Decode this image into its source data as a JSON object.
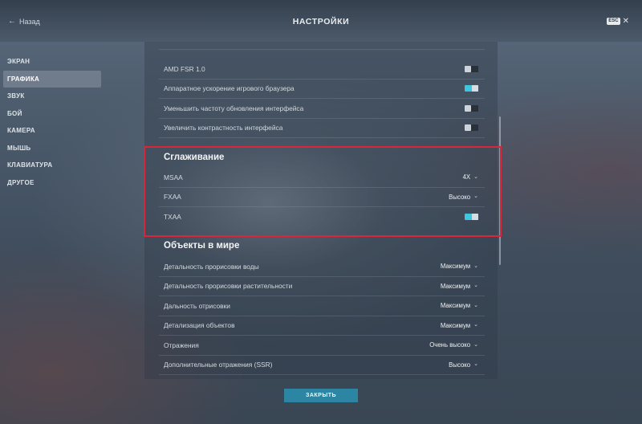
{
  "header": {
    "back_label": "Назад",
    "title": "НАСТРОЙКИ",
    "esc_key": "ESC",
    "close_glyph": "✕",
    "back_icon": "arrow-left-icon"
  },
  "sidebar": {
    "items": [
      {
        "label": "ЭКРАН"
      },
      {
        "label": "ГРАФИКА",
        "active": true
      },
      {
        "label": "ЗВУК"
      },
      {
        "label": "БОЙ"
      },
      {
        "label": "КАМЕРА"
      },
      {
        "label": "МЫШЬ"
      },
      {
        "label": "КЛАВИАТУРА"
      },
      {
        "label": "ДРУГОЕ"
      }
    ]
  },
  "top_toggles": [
    {
      "label": "AMD FSR 1.0",
      "state": "off"
    },
    {
      "label": "Аппаратное ускорение игрового браузера",
      "state": "on"
    },
    {
      "label": "Уменьшить частоту обновления интерфейса",
      "state": "off"
    },
    {
      "label": "Увеличить контрастность интерфейса",
      "state": "off"
    }
  ],
  "antialiasing": {
    "title": "Сглаживание",
    "msaa": {
      "label": "MSAA",
      "value": "4X"
    },
    "fxaa": {
      "label": "FXAA",
      "value": "Высоко"
    },
    "txaa": {
      "label": "TXAA",
      "state": "on"
    }
  },
  "world_objects": {
    "title": "Объекты в мире",
    "rows": [
      {
        "label": "Детальность прорисовки воды",
        "value": "Максимум"
      },
      {
        "label": "Детальность прорисовки растительности",
        "value": "Максимум"
      },
      {
        "label": "Дальность отрисовки",
        "value": "Максимум"
      },
      {
        "label": "Детализация объектов",
        "value": "Максимум"
      },
      {
        "label": "Отражения",
        "value": "Очень высоко"
      },
      {
        "label": "Дополнительные отражения (SSR)",
        "value": "Высоко"
      }
    ]
  },
  "footer": {
    "close_label": "ЗАКРЫТЬ"
  },
  "colors": {
    "toggle_on": "#3dc6e0",
    "highlight_border": "#d9263a",
    "close_button": "#2c86a3"
  }
}
